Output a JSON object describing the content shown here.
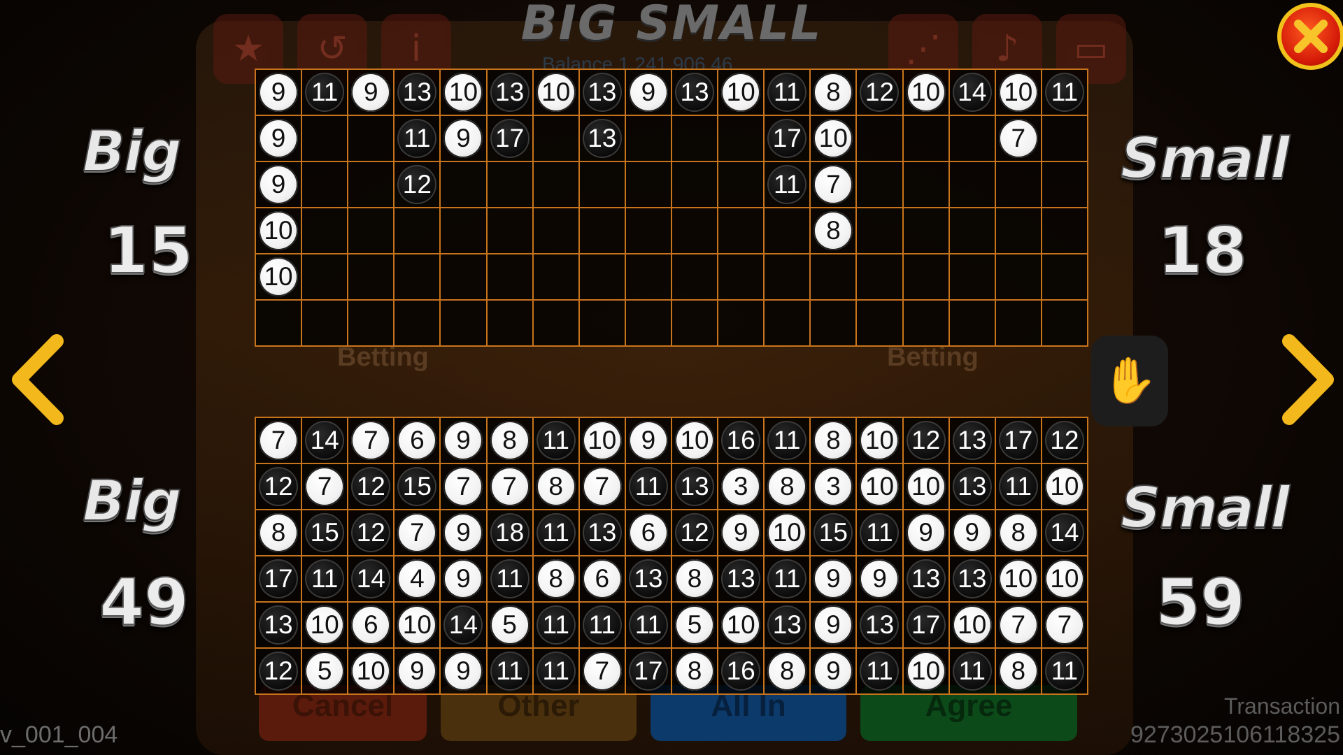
{
  "background": {
    "title": "BIG SMALL",
    "balance": "Balance 1,241,906.46",
    "betting_left": "Betting",
    "betting_right": "Betting",
    "buttons": [
      "Cancel",
      "Other",
      "All In",
      "Agree"
    ],
    "icons": [
      "trophy-icon",
      "history-icon",
      "info-icon",
      "trend-icon",
      "sound-icon",
      "chat-icon"
    ]
  },
  "top_grid": {
    "rows": [
      [
        [
          "9",
          "w"
        ],
        [
          "11",
          "b"
        ],
        [
          "9",
          "w"
        ],
        [
          "13",
          "b"
        ],
        [
          "10",
          "w"
        ],
        [
          "13",
          "b"
        ],
        [
          "10",
          "w"
        ],
        [
          "13",
          "b"
        ],
        [
          "9",
          "w"
        ],
        [
          "13",
          "b"
        ],
        [
          "10",
          "w"
        ],
        [
          "11",
          "b"
        ],
        [
          "8",
          "w"
        ],
        [
          "12",
          "b"
        ],
        [
          "10",
          "w"
        ],
        [
          "14",
          "b"
        ],
        [
          "10",
          "w"
        ],
        [
          "11",
          "b"
        ]
      ],
      [
        [
          "9",
          "w"
        ],
        null,
        null,
        [
          "11",
          "b"
        ],
        [
          "9",
          "w"
        ],
        [
          "17",
          "b"
        ],
        null,
        [
          "13",
          "b"
        ],
        null,
        null,
        null,
        [
          "17",
          "b"
        ],
        [
          "10",
          "w"
        ],
        null,
        null,
        null,
        [
          "7",
          "w"
        ],
        null
      ],
      [
        [
          "9",
          "w"
        ],
        null,
        null,
        [
          "12",
          "b"
        ],
        null,
        null,
        null,
        null,
        null,
        null,
        null,
        [
          "11",
          "b"
        ],
        [
          "7",
          "w"
        ],
        null,
        null,
        null,
        null,
        null
      ],
      [
        [
          "10",
          "w"
        ],
        null,
        null,
        null,
        null,
        null,
        null,
        null,
        null,
        null,
        null,
        null,
        [
          "8",
          "w"
        ],
        null,
        null,
        null,
        null,
        null
      ],
      [
        [
          "10",
          "w"
        ],
        null,
        null,
        null,
        null,
        null,
        null,
        null,
        null,
        null,
        null,
        null,
        null,
        null,
        null,
        null,
        null,
        null
      ],
      [
        null,
        null,
        null,
        null,
        null,
        null,
        null,
        null,
        null,
        null,
        null,
        null,
        null,
        null,
        null,
        null,
        null,
        null
      ]
    ]
  },
  "bottom_grid": {
    "rows": [
      [
        [
          "7",
          "w"
        ],
        [
          "14",
          "b"
        ],
        [
          "7",
          "w"
        ],
        [
          "6",
          "w"
        ],
        [
          "9",
          "w"
        ],
        [
          "8",
          "w"
        ],
        [
          "11",
          "b"
        ],
        [
          "10",
          "w"
        ],
        [
          "9",
          "w"
        ],
        [
          "10",
          "w"
        ],
        [
          "16",
          "b"
        ],
        [
          "11",
          "b"
        ],
        [
          "8",
          "w"
        ],
        [
          "10",
          "w"
        ],
        [
          "12",
          "b"
        ],
        [
          "13",
          "b"
        ],
        [
          "17",
          "b"
        ],
        [
          "12",
          "b"
        ]
      ],
      [
        [
          "12",
          "b"
        ],
        [
          "7",
          "w"
        ],
        [
          "12",
          "b"
        ],
        [
          "15",
          "b"
        ],
        [
          "7",
          "w"
        ],
        [
          "7",
          "w"
        ],
        [
          "8",
          "w"
        ],
        [
          "7",
          "w"
        ],
        [
          "11",
          "b"
        ],
        [
          "13",
          "b"
        ],
        [
          "3",
          "w"
        ],
        [
          "8",
          "w"
        ],
        [
          "3",
          "w"
        ],
        [
          "10",
          "w"
        ],
        [
          "10",
          "w"
        ],
        [
          "13",
          "b"
        ],
        [
          "11",
          "b"
        ],
        [
          "10",
          "w"
        ]
      ],
      [
        [
          "8",
          "w"
        ],
        [
          "15",
          "b"
        ],
        [
          "12",
          "b"
        ],
        [
          "7",
          "w"
        ],
        [
          "9",
          "w"
        ],
        [
          "18",
          "b"
        ],
        [
          "11",
          "b"
        ],
        [
          "13",
          "b"
        ],
        [
          "6",
          "w"
        ],
        [
          "12",
          "b"
        ],
        [
          "9",
          "w"
        ],
        [
          "10",
          "w"
        ],
        [
          "15",
          "b"
        ],
        [
          "11",
          "b"
        ],
        [
          "9",
          "w"
        ],
        [
          "9",
          "w"
        ],
        [
          "8",
          "w"
        ],
        [
          "14",
          "b"
        ]
      ],
      [
        [
          "17",
          "b"
        ],
        [
          "11",
          "b"
        ],
        [
          "14",
          "b"
        ],
        [
          "4",
          "w"
        ],
        [
          "9",
          "w"
        ],
        [
          "11",
          "b"
        ],
        [
          "8",
          "w"
        ],
        [
          "6",
          "w"
        ],
        [
          "13",
          "b"
        ],
        [
          "8",
          "w"
        ],
        [
          "13",
          "b"
        ],
        [
          "11",
          "b"
        ],
        [
          "9",
          "w"
        ],
        [
          "9",
          "w"
        ],
        [
          "13",
          "b"
        ],
        [
          "13",
          "b"
        ],
        [
          "10",
          "w"
        ],
        [
          "10",
          "w"
        ]
      ],
      [
        [
          "13",
          "b"
        ],
        [
          "10",
          "w"
        ],
        [
          "6",
          "w"
        ],
        [
          "10",
          "w"
        ],
        [
          "14",
          "b"
        ],
        [
          "5",
          "w"
        ],
        [
          "11",
          "b"
        ],
        [
          "11",
          "b"
        ],
        [
          "11",
          "b"
        ],
        [
          "5",
          "w"
        ],
        [
          "10",
          "w"
        ],
        [
          "13",
          "b"
        ],
        [
          "9",
          "w"
        ],
        [
          "13",
          "b"
        ],
        [
          "17",
          "b"
        ],
        [
          "10",
          "w"
        ],
        [
          "7",
          "w"
        ],
        [
          "7",
          "w"
        ]
      ],
      [
        [
          "12",
          "b"
        ],
        [
          "5",
          "w"
        ],
        [
          "10",
          "w"
        ],
        [
          "9",
          "w"
        ],
        [
          "9",
          "w"
        ],
        [
          "11",
          "b"
        ],
        [
          "11",
          "b"
        ],
        [
          "7",
          "w"
        ],
        [
          "17",
          "b"
        ],
        [
          "8",
          "w"
        ],
        [
          "16",
          "b"
        ],
        [
          "8",
          "w"
        ],
        [
          "9",
          "w"
        ],
        [
          "11",
          "b"
        ],
        [
          "10",
          "w"
        ],
        [
          "11",
          "b"
        ],
        [
          "8",
          "w"
        ],
        [
          "11",
          "b"
        ]
      ]
    ]
  },
  "top_stats": {
    "big_label": "Big",
    "big_count": "15",
    "small_label": "Small",
    "small_count": "18"
  },
  "bottom_stats": {
    "big_label": "Big",
    "big_count": "49",
    "small_label": "Small",
    "small_count": "59"
  },
  "footer": {
    "version": "v_001_004",
    "transaction_label": "Transaction",
    "transaction_id": "9273025106118325"
  },
  "colors": {
    "grid_line": "#c8741c",
    "accent_arrow": "#f2b81c",
    "close_red": "#d41a08"
  }
}
